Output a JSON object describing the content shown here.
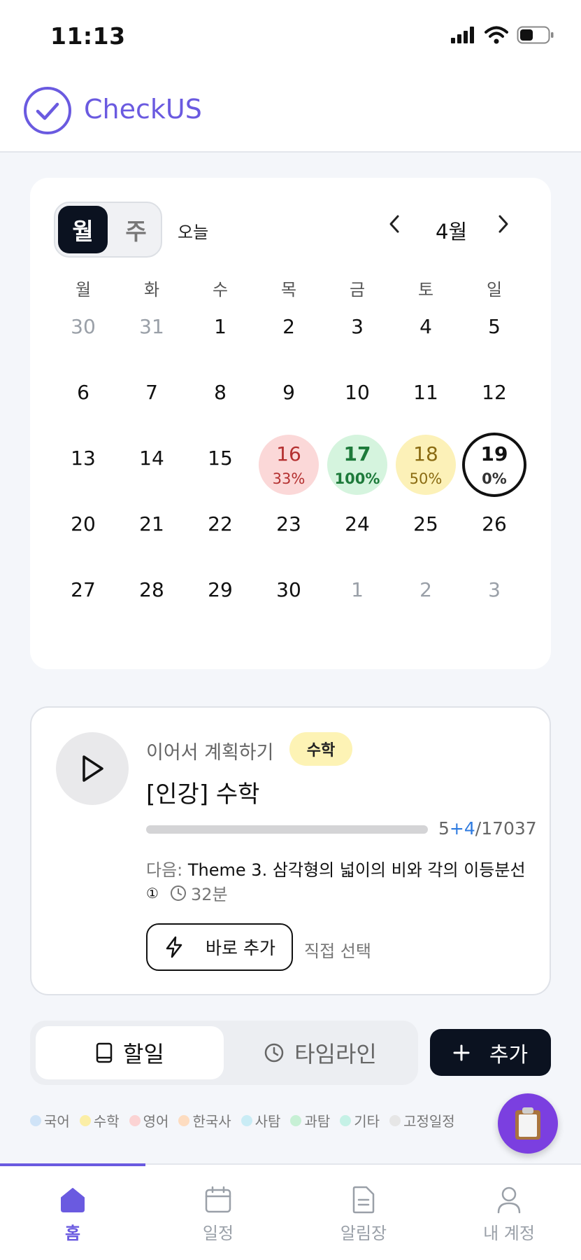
{
  "status_bar": {
    "time": "11:13"
  },
  "app": {
    "title": "CheckUS"
  },
  "calendar": {
    "view_toggle": {
      "month": "월",
      "week": "주"
    },
    "today": "오늘",
    "month_label": "4월",
    "weekdays": [
      "월",
      "화",
      "수",
      "목",
      "금",
      "토",
      "일"
    ],
    "weeks": [
      [
        "30",
        "31",
        "1",
        "2",
        "3",
        "4",
        "5"
      ],
      [
        "6",
        "7",
        "8",
        "9",
        "10",
        "11",
        "12"
      ],
      [
        "13",
        "14",
        "15",
        "16",
        "17",
        "18",
        "19"
      ],
      [
        "20",
        "21",
        "22",
        "23",
        "24",
        "25",
        "26"
      ],
      [
        "27",
        "28",
        "29",
        "30",
        "1",
        "2",
        "3"
      ]
    ],
    "progress_days": {
      "d16": {
        "day": "16",
        "pct": "33%"
      },
      "d17": {
        "day": "17",
        "pct": "100%"
      },
      "d18": {
        "day": "18",
        "pct": "50%"
      },
      "d19": {
        "day": "19",
        "pct": "0%"
      }
    }
  },
  "plan": {
    "label": "이어서 계획하기",
    "subject_badge": "수학",
    "title": "[인강] 수학",
    "progress": {
      "done": "5",
      "added": "+4",
      "total": "/17037",
      "fraction": 0.0005
    },
    "next_label": "다음:",
    "next_title": "Theme 3. 삼각형의 넓이의 비와 각의 이등분선",
    "index_mark": "①",
    "duration": "32분",
    "quick_add": "바로 추가",
    "manual_select": "직접 선택"
  },
  "tabs": {
    "todo": "할일",
    "timeline": "타임라인",
    "add": "추가"
  },
  "legend": [
    {
      "label": "국어",
      "color": "#cfe3f7"
    },
    {
      "label": "수학",
      "color": "#fbeea6"
    },
    {
      "label": "영어",
      "color": "#fbd3d3"
    },
    {
      "label": "한국사",
      "color": "#fddcc0"
    },
    {
      "label": "사탐",
      "color": "#c9ecf5"
    },
    {
      "label": "과탐",
      "color": "#c7f0d5"
    },
    {
      "label": "기타",
      "color": "#c5f1e6"
    },
    {
      "label": "고정일정",
      "color": "#e6e6e6"
    }
  ],
  "bottom_nav": {
    "home": "홈",
    "schedule": "일정",
    "notices": "알림장",
    "account": "내 계정"
  },
  "colors": {
    "accent": "#6a5ae0",
    "dark": "#0b1220",
    "fab": "#7b3fe0"
  }
}
